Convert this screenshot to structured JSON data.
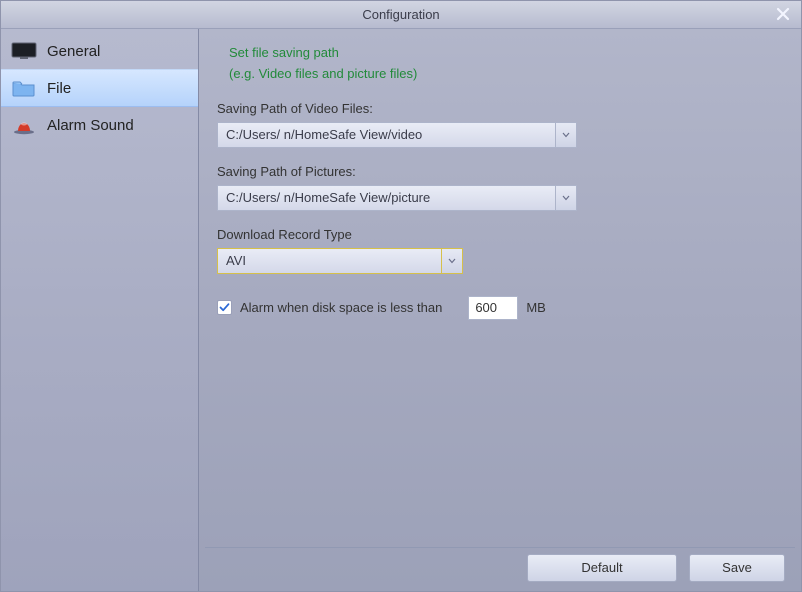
{
  "title": "Configuration",
  "sidebar": {
    "items": [
      {
        "label": "General"
      },
      {
        "label": "File"
      },
      {
        "label": "Alarm Sound"
      }
    ],
    "activeIndex": 1
  },
  "file": {
    "hint_line1": "Set file saving path",
    "hint_line2": "(e.g. Video files and picture files)",
    "video_label": "Saving Path of Video Files:",
    "video_path": "C:/Users/             n/HomeSafe View/video",
    "picture_label": "Saving Path of Pictures:",
    "picture_path": "C:/Users/             n/HomeSafe View/picture",
    "download_type_label": "Download Record Type",
    "download_type_value": "AVI",
    "alarm_checked": true,
    "alarm_label": "Alarm when disk space is less than",
    "alarm_value": "600",
    "alarm_unit": "MB"
  },
  "footer": {
    "default_label": "Default",
    "save_label": "Save"
  }
}
